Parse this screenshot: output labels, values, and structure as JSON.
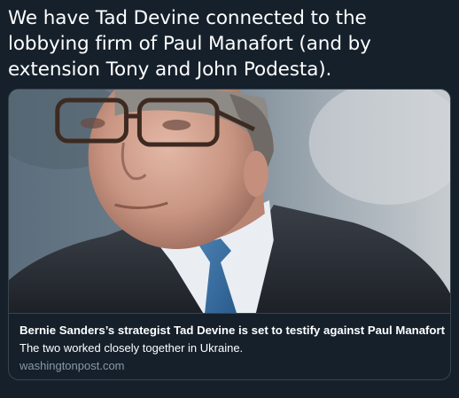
{
  "tweet": {
    "text": "We have Tad Devine connected to the lobbying firm of Paul Manafort (and by extension Tony and John Podesta)."
  },
  "card": {
    "image_alt": "Photo of Tad Devine wearing glasses, a dark suit and a blue tie",
    "title": "Bernie Sanders’s strategist Tad Devine is set to testify against Paul Manafort",
    "description": "The two worked closely together in Ukraine.",
    "domain": "washingtonpost.com"
  },
  "colors": {
    "background": "#15202b",
    "card_border": "#38444d",
    "text_primary": "#ffffff",
    "text_secondary": "#8899a6"
  }
}
